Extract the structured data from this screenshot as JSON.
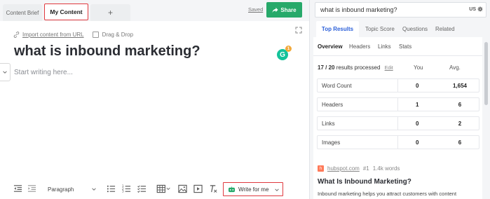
{
  "editor": {
    "tabs": {
      "brief": "Content Brief",
      "my_content": "My Content",
      "add": "+"
    },
    "saved_label": "Saved",
    "share_label": "Share",
    "import_label": "Import content from URL",
    "drag_drop_label": "Drag & Drop",
    "title": "what is inbound marketing?",
    "grammarly_badge": "1",
    "placeholder": "Start writing here...",
    "toolbar": {
      "paragraph_select": "Paragraph",
      "write_for_me": "Write for me"
    }
  },
  "research": {
    "search_value": "what is inbound marketing?",
    "region": "US",
    "tabs": [
      "Top Results",
      "Topic Score",
      "Questions",
      "Related"
    ],
    "active_tab": "Top Results",
    "subtabs": [
      "Overview",
      "Headers",
      "Links",
      "Stats"
    ],
    "active_subtab": "Overview",
    "processed_count": "17 / 20",
    "processed_text": "results processed",
    "edit_label": "Edit",
    "col_you": "You",
    "col_avg": "Avg.",
    "metrics": [
      {
        "label": "Word Count",
        "you": "0",
        "avg": "1,654"
      },
      {
        "label": "Headers",
        "you": "1",
        "avg": "6"
      },
      {
        "label": "Links",
        "you": "0",
        "avg": "2"
      },
      {
        "label": "Images",
        "you": "0",
        "avg": "6"
      }
    ],
    "top_result": {
      "domain": "hubspot.com",
      "rank": "#1",
      "words": "1.4k words",
      "title": "What Is Inbound Marketing?",
      "snippet": "Inbound marketing helps you attract customers with content"
    }
  },
  "colors": {
    "accent_green": "#27a96a",
    "highlight_red": "#e0393e",
    "link_blue": "#2b5fd9"
  },
  "icons": [
    "link-icon",
    "checkbox-icon",
    "expand-icon",
    "share-icon",
    "grammarly-icon",
    "chevron-down-icon",
    "outdent-icon",
    "indent-icon",
    "bullet-list-icon",
    "numbered-list-icon",
    "checklist-icon",
    "table-icon",
    "image-icon",
    "video-icon",
    "clear-format-icon",
    "robot-icon",
    "gear-icon"
  ]
}
